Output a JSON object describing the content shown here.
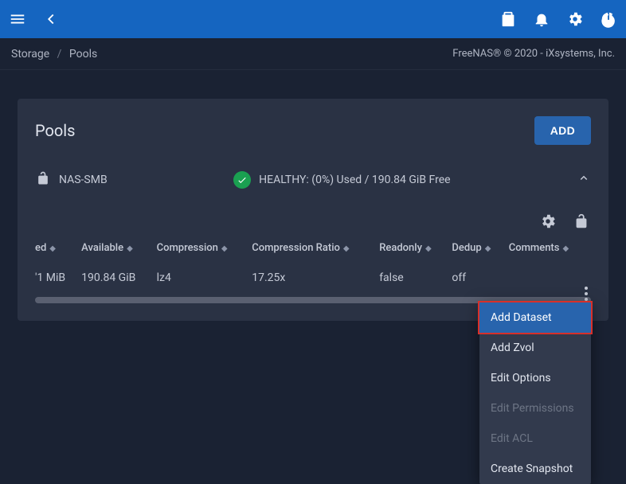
{
  "breadcrumb": {
    "root": "Storage",
    "leaf": "Pools"
  },
  "brand": "FreeNAS® © 2020 - iXsystems, Inc.",
  "panel": {
    "title": "Pools",
    "add_label": "ADD"
  },
  "pool": {
    "name": "NAS-SMB",
    "status_text": "HEALTHY: (0%) Used / 190.84 GiB Free"
  },
  "table": {
    "headers": {
      "used_trunc": "ed",
      "available": "Available",
      "compression": "Compression",
      "compression_ratio": "Compression Ratio",
      "readonly": "Readonly",
      "dedup": "Dedup",
      "comments": "Comments"
    },
    "row": {
      "used_trunc": "'1 MiB",
      "available": "190.84 GiB",
      "compression": "lz4",
      "compression_ratio": "17.25x",
      "readonly": "false",
      "dedup": "off",
      "comments": ""
    }
  },
  "context_menu": {
    "add_dataset": "Add Dataset",
    "add_zvol": "Add Zvol",
    "edit_options": "Edit Options",
    "edit_permissions": "Edit Permissions",
    "edit_acl": "Edit ACL",
    "create_snapshot": "Create Snapshot"
  }
}
